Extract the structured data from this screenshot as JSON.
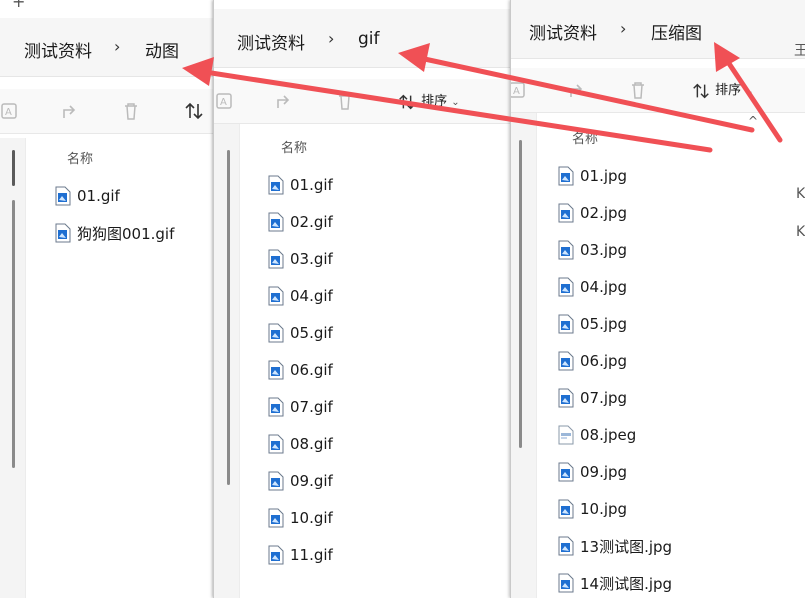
{
  "window1": {
    "breadcrumb": [
      "测试资料",
      "动图"
    ],
    "column_header": "名称",
    "files": [
      {
        "name": "01.gif",
        "type": "image"
      },
      {
        "name": "狗狗图001.gif",
        "type": "image"
      }
    ]
  },
  "window2": {
    "breadcrumb": [
      "测试资料",
      "gif"
    ],
    "sort_label": "排序",
    "column_header": "名称",
    "files": [
      {
        "name": "01.gif",
        "type": "image"
      },
      {
        "name": "02.gif",
        "type": "image"
      },
      {
        "name": "03.gif",
        "type": "image"
      },
      {
        "name": "04.gif",
        "type": "image"
      },
      {
        "name": "05.gif",
        "type": "image"
      },
      {
        "name": "06.gif",
        "type": "image"
      },
      {
        "name": "07.gif",
        "type": "image"
      },
      {
        "name": "08.gif",
        "type": "image"
      },
      {
        "name": "09.gif",
        "type": "image"
      },
      {
        "name": "10.gif",
        "type": "image"
      },
      {
        "name": "11.gif",
        "type": "image"
      }
    ]
  },
  "window3": {
    "breadcrumb": [
      "测试资料",
      "压缩图"
    ],
    "sort_label": "排序",
    "column_header": "名称",
    "files": [
      {
        "name": "01.jpg",
        "type": "image"
      },
      {
        "name": "02.jpg",
        "type": "image"
      },
      {
        "name": "03.jpg",
        "type": "image"
      },
      {
        "name": "04.jpg",
        "type": "image"
      },
      {
        "name": "05.jpg",
        "type": "image"
      },
      {
        "name": "06.jpg",
        "type": "image"
      },
      {
        "name": "07.jpg",
        "type": "image"
      },
      {
        "name": "08.jpeg",
        "type": "jpeg"
      },
      {
        "name": "09.jpg",
        "type": "image"
      },
      {
        "name": "10.jpg",
        "type": "image"
      },
      {
        "name": "13测试图.jpg",
        "type": "image"
      },
      {
        "name": "14测试图.jpg",
        "type": "image"
      }
    ],
    "edge_chars": [
      "王",
      "K",
      "K"
    ]
  },
  "colors": {
    "arrow": "#f05055",
    "icon_blue": "#1f6fd1"
  }
}
